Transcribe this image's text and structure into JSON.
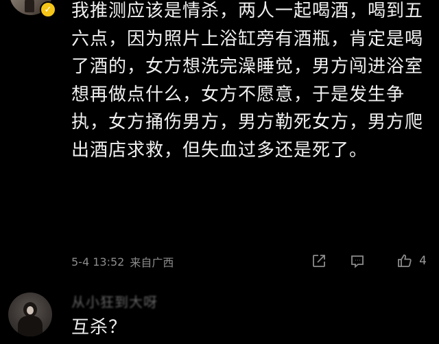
{
  "comment": {
    "avatar_badge": "✓",
    "text": "我推测应该是情杀，两人一起喝酒，喝到五六点，因为照片上浴缸旁有酒瓶，肯定是喝了酒的，女方想洗完澡睡觉，男方闯进浴室想再做点什么，女方不愿意，于是发生争执，女方捅伤男方，男方勒死女方，男方爬出酒店求救，但失血过多还是死了。",
    "timestamp": "5-4 13:52",
    "location": "来自广西",
    "like_count": "4",
    "icons": {
      "share": "share-icon",
      "comment": "comment-icon",
      "like": "thumbs-up-icon",
      "verified": "verified-badge-icon"
    }
  },
  "reply": {
    "username": "从小狂到大呀",
    "text": "互杀？"
  },
  "colors": {
    "background": "#000000",
    "text": "#f0f0f0",
    "meta": "#8c8c8c",
    "badge": "#f5c518"
  }
}
